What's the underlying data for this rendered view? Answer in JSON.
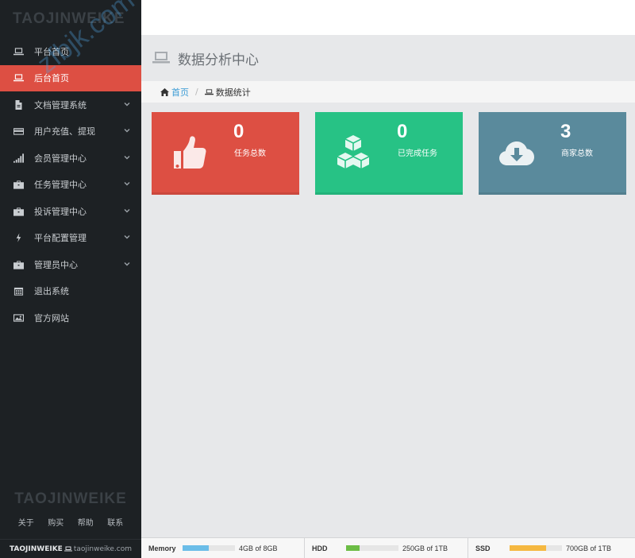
{
  "brand": {
    "logo": "TAOJINWEIKE"
  },
  "sidebar": {
    "items": [
      {
        "label": "平台首页",
        "icon": "laptop-icon",
        "caret": false,
        "active": false
      },
      {
        "label": "后台首页",
        "icon": "laptop-icon",
        "caret": false,
        "active": true
      },
      {
        "label": "文档管理系统",
        "icon": "file-icon",
        "caret": true,
        "active": false
      },
      {
        "label": "用户充值、提现",
        "icon": "credit-card-icon",
        "caret": true,
        "active": false
      },
      {
        "label": "会员管理中心",
        "icon": "signal-icon",
        "caret": true,
        "active": false
      },
      {
        "label": "任务管理中心",
        "icon": "briefcase-icon",
        "caret": true,
        "active": false
      },
      {
        "label": "投诉管理中心",
        "icon": "briefcase-icon",
        "caret": true,
        "active": false
      },
      {
        "label": "平台配置管理",
        "icon": "bolt-icon",
        "caret": true,
        "active": false
      },
      {
        "label": "管理员中心",
        "icon": "briefcase-icon",
        "caret": true,
        "active": false
      },
      {
        "label": "退出系统",
        "icon": "calendar-icon",
        "caret": false,
        "active": false
      },
      {
        "label": "官方网站",
        "icon": "picture-icon",
        "caret": false,
        "active": false
      }
    ],
    "footer": {
      "logo": "TAOJINWEIKE",
      "links": [
        "关于",
        "购买",
        "帮助",
        "联系"
      ],
      "brand": "TAOJINWEIKE",
      "site": "taojinweike.com"
    }
  },
  "header": {
    "title": "数据分析中心"
  },
  "breadcrumb": {
    "home": "首页",
    "separator": "/",
    "current": "数据统计"
  },
  "cards": [
    {
      "value": "0",
      "label": "任务总数",
      "icon": "thumbs-up-icon",
      "color": "#dd4f43"
    },
    {
      "value": "0",
      "label": "已完成任务",
      "icon": "cubes-icon",
      "color": "#27c285"
    },
    {
      "value": "3",
      "label": "商家总数",
      "icon": "cloud-download-icon",
      "color": "#5a8a9c"
    }
  ],
  "status": [
    {
      "name": "Memory",
      "text": "4GB of 8GB",
      "fraction": 0.5,
      "color": "#6bbde8"
    },
    {
      "name": "HDD",
      "text": "250GB of 1TB",
      "fraction": 0.25,
      "color": "#6cbd45"
    },
    {
      "name": "SSD",
      "text": "700GB of 1TB",
      "fraction": 0.7,
      "color": "#f5b841"
    }
  ],
  "watermark": "zfbjk.com"
}
